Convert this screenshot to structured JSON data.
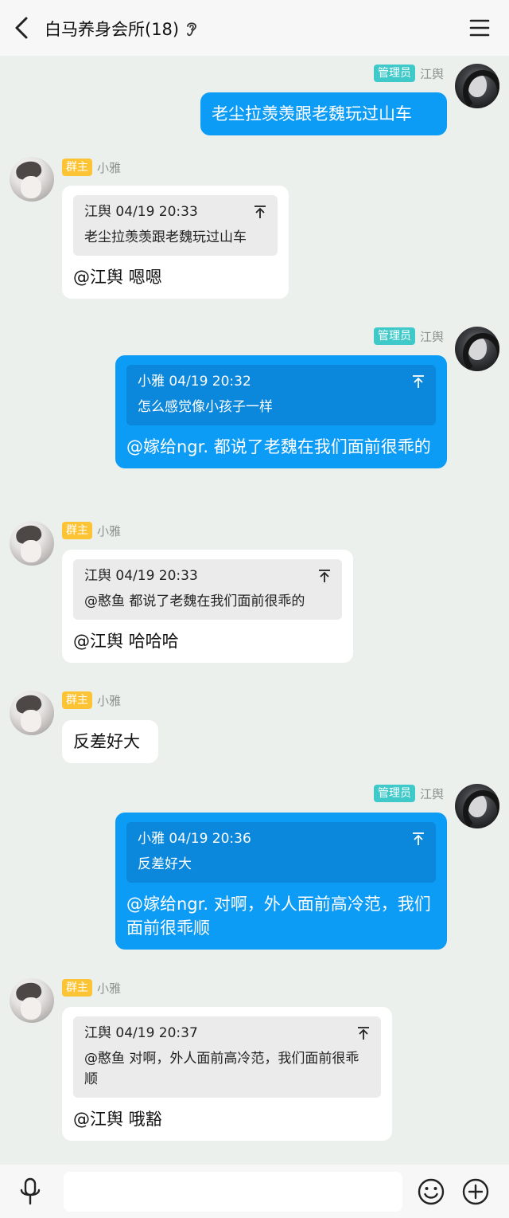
{
  "header": {
    "title": "白马养身会所(18)",
    "back_icon": "chevron-left-icon",
    "ear_icon": "ear-icon",
    "menu_icon": "hamburger-menu-icon"
  },
  "roles": {
    "admin_badge": "管理员",
    "owner_badge": "群主"
  },
  "colors": {
    "outgoing_bubble": "#0c9bf5",
    "incoming_bubble": "#ffffff",
    "admin_badge": "#3fc9c9",
    "owner_badge": "#fcc335",
    "background": "#ebf0ec"
  },
  "messages": [
    {
      "sender": "江舆",
      "text": "老尘拉羡羡跟老魏玩过山车"
    },
    {
      "sender": "小雅",
      "quote": {
        "author_time": "江舆 04/19 20:33",
        "text": "老尘拉羡羡跟老魏玩过山车"
      },
      "text": "@江舆 嗯嗯"
    },
    {
      "sender": "江舆",
      "quote": {
        "author_time": "小雅 04/19 20:32",
        "text": "怎么感觉像小孩子一样"
      },
      "text": "@嫁给ngr. 都说了老魏在我们面前很乖的"
    },
    {
      "sender": "小雅",
      "quote": {
        "author_time": "江舆 04/19 20:33",
        "text": "@憨鱼 都说了老魏在我们面前很乖的"
      },
      "text": "@江舆 哈哈哈"
    },
    {
      "sender": "小雅",
      "text": "反差好大"
    },
    {
      "sender": "江舆",
      "quote": {
        "author_time": "小雅 04/19 20:36",
        "text": "反差好大"
      },
      "text": "@嫁给ngr. 对啊，外人面前高冷范，我们面前很乖顺"
    },
    {
      "sender": "小雅",
      "quote": {
        "author_time": "江舆 04/19 20:37",
        "text": "@憨鱼 对啊，外人面前高冷范，我们面前很乖顺"
      },
      "text": "@江舆 哦豁"
    }
  ],
  "footer": {
    "input_placeholder": "",
    "voice_icon": "microphone-icon",
    "emoji_icon": "smiley-icon",
    "more_icon": "plus-circle-icon"
  }
}
